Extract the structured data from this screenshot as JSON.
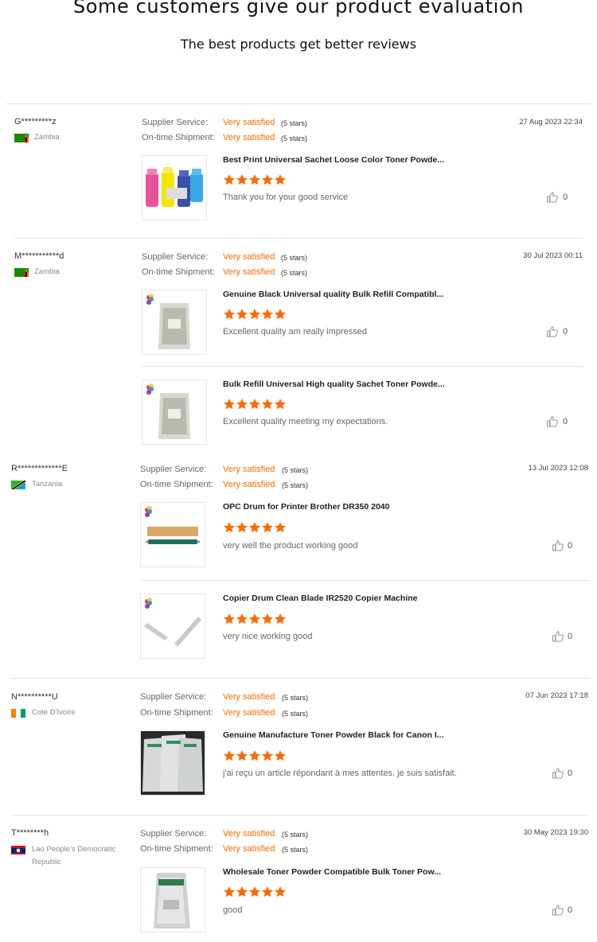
{
  "header": {
    "title": "Some customers give our product evaluation",
    "subtitle": "The best products get better reviews"
  },
  "labels": {
    "supplier_service": "Supplier Service:",
    "ontime_shipment": "On-time Shipment:",
    "very_satisfied": "Very satisfied",
    "five_stars": "(5 stars)"
  },
  "colors": {
    "accent": "#ff6a00",
    "star": "#ff6a00"
  },
  "reviews": [
    {
      "user": "G*********z",
      "country": "Zambia",
      "date": "27 Aug 2023 22:34",
      "products": [
        {
          "title": "Best Print Universal Sachet Loose Color Toner Powde...",
          "rating": 5,
          "comment": "Thank you for your good service",
          "likes": "0"
        }
      ]
    },
    {
      "user": "M***********d",
      "country": "Zambia",
      "date": "30 Jul 2023 00:11",
      "products": [
        {
          "title": "Genuine Black Universal quality Bulk Refill Compatibl...",
          "rating": 5,
          "comment": "Excellent quality am really impressed",
          "likes": "0"
        },
        {
          "title": "Bulk Refill Universal High quality Sachet Toner Powde...",
          "rating": 5,
          "comment": "Excellent quality meeting my expectations.",
          "likes": "0"
        }
      ]
    },
    {
      "user": "R*************E",
      "country": "Tanzania",
      "date": "13 Jul 2023 12:08",
      "products": [
        {
          "title": "OPC Drum for Printer Brother DR350 2040",
          "rating": 5,
          "comment": "very well the product working good",
          "likes": "0"
        },
        {
          "title": "Copier Drum Clean Blade IR2520 Copier Machine",
          "rating": 5,
          "comment": "very nice working good",
          "likes": "0"
        }
      ]
    },
    {
      "user": "N**********U",
      "country": "Cote D'Ivoire",
      "date": "07 Jun 2023 17:18",
      "products": [
        {
          "title": "Genuine Manufacture Toner Powder Black for Canon I...",
          "rating": 5,
          "comment": "j'ai reçu un article répondant à mes attentes. je suis satisfait.",
          "likes": "0"
        }
      ]
    },
    {
      "user": "T********h",
      "country": "Lao People's Democratic Republic",
      "date": "30 May 2023 19:30",
      "products": [
        {
          "title": "Wholesale Toner Powder Compatible Bulk Toner Pow...",
          "rating": 5,
          "comment": "good",
          "likes": "0"
        }
      ]
    }
  ]
}
